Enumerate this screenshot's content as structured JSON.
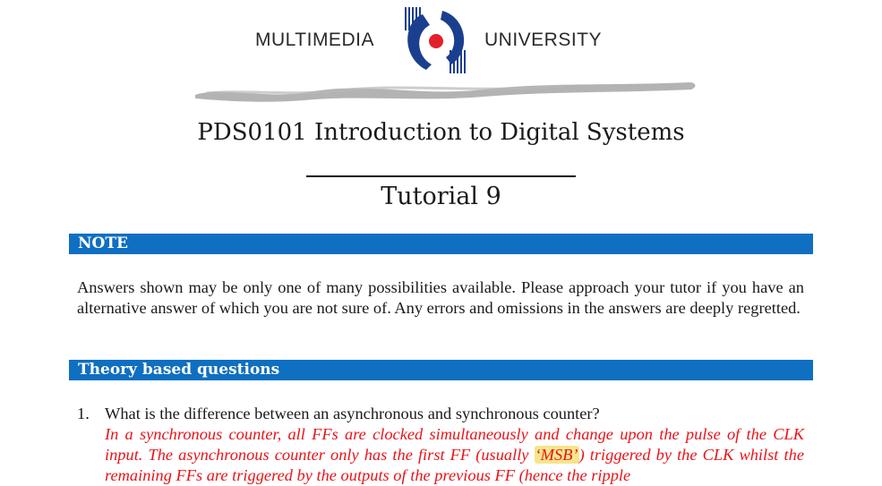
{
  "header": {
    "logo_left": "MULTIMEDIA",
    "logo_right": "UNIVERSITY",
    "logo_icon": "university-emblem-icon"
  },
  "document": {
    "title": "PDS0101 Introduction to Digital Systems",
    "subtitle": "Tutorial 9"
  },
  "note": {
    "heading": "NOTE",
    "body": "Answers shown may be only one of many possibilities available. Please approach your tutor if you have an alternative answer of which you are not sure of. Any errors and omissions in the answers are deeply regretted."
  },
  "theory": {
    "heading": "Theory based questions",
    "questions": [
      {
        "number": "1.",
        "question": "What is the difference between an asynchronous and synchronous counter?",
        "answer_part1": "In a synchronous counter, all FFs are clocked simultaneously and change upon the pulse of the CLK input. The asynchronous counter only has the first FF (usually ",
        "answer_highlight": "‘MSB’",
        "answer_part2": ") triggered by the CLK whilst the remaining FFs are triggered by the outputs of the previous FF (hence the ripple"
      }
    ]
  },
  "colors": {
    "bar_blue": "#0f6fc1",
    "answer_red": "#e8141a",
    "highlight_yellow": "#f6e58c",
    "logo_blue": "#1b3f8f",
    "logo_red": "#e3202b"
  }
}
